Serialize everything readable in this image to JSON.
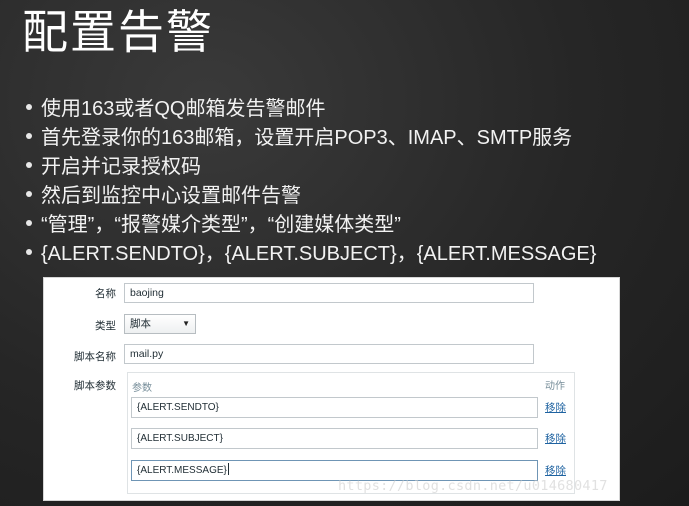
{
  "slide": {
    "title": "配置告警",
    "bullets": [
      "使用163或者QQ邮箱发告警邮件",
      "首先登录你的163邮箱，设置开启POP3、IMAP、SMTP服务",
      "开启并记录授权码",
      "然后到监控中心设置邮件告警",
      "“管理”，“报警媒介类型”，“创建媒体类型”",
      "{ALERT.SENDTO}，{ALERT.SUBJECT}，{ALERT.MESSAGE}"
    ]
  },
  "form": {
    "name_label": "名称",
    "name_value": "baojing",
    "type_label": "类型",
    "type_value": "脚本",
    "script_name_label": "脚本名称",
    "script_name_value": "mail.py",
    "script_params_label": "脚本参数",
    "params_header": "参数",
    "action_header": "动作",
    "params": [
      {
        "value": "{ALERT.SENDTO}",
        "action": "移除"
      },
      {
        "value": "{ALERT.SUBJECT}",
        "action": "移除"
      },
      {
        "value": "{ALERT.MESSAGE}",
        "action": "移除"
      }
    ]
  },
  "watermark": "https://blog.csdn.net/u014680417",
  "colors": {
    "link": "#1f63a1",
    "header_text": "#768d99",
    "label_text": "#1f2c33"
  },
  "icons": {
    "bullet": "bullet-dot",
    "select_arrow": "caret-down"
  }
}
